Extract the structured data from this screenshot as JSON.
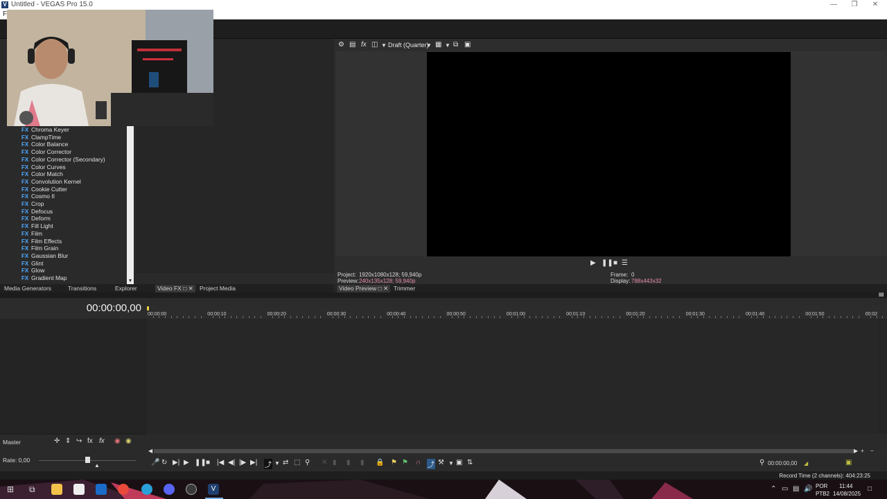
{
  "window": {
    "title": "Untitled - VEGAS Pro 15.0",
    "app_icon_letter": "V"
  },
  "menubar": {
    "first_item": "Fi"
  },
  "fx_list": [
    "Chroma Keyer",
    "ClampTime",
    "Color Balance",
    "Color Corrector",
    "Color Corrector (Secondary)",
    "Color Curves",
    "Color Match",
    "Convolution Kernel",
    "Cookie Cutter",
    "Cosmo II",
    "Crop",
    "Defocus",
    "Deform",
    "Fill Light",
    "Film",
    "Film Effects",
    "Film Grain",
    "Gaussian Blur",
    "Glint",
    "Glow",
    "Gradient Map"
  ],
  "fx_badge": "FX",
  "left_tabs": [
    "Media Generators",
    "Transitions",
    "Explorer",
    "Video FX",
    "Project Media"
  ],
  "preview_toolbar": {
    "quality": "Draft (Quarter)"
  },
  "preview_info": {
    "project_label": "Project:",
    "project_value": "1920x1080x128; 59,940p",
    "preview_label": "Preview:",
    "preview_value": "240x135x128; 59,940p",
    "frame_label": "Frame:",
    "frame_value": "0",
    "display_label": "Display:",
    "display_value": "788x443x32"
  },
  "preview_tabs": [
    "Video Preview",
    "Trimmer"
  ],
  "timeline": {
    "timecode": "00:00:00,00",
    "ruler": [
      "00:00:00",
      "00:00:10",
      "00:00:20",
      "00:00:30",
      "00:00:40",
      "00:00:50",
      "00:01:00",
      "00:01:10",
      "00:01:20",
      "00:01:30",
      "00:01:40",
      "00:01:50",
      "00:02"
    ]
  },
  "mixer": {
    "master_label": "Master",
    "rate_label": "Rate: 0,00"
  },
  "transport": {
    "cursor_time": "00:00:00,00"
  },
  "status": {
    "record_time": "Record Time (2 channels): 404:23:25"
  },
  "taskbar": {
    "lang1": "POR",
    "lang2": "PTB2",
    "time": "11:44",
    "date": "14/08/2025"
  },
  "colors": {
    "accent_fx": "#4fa8ff",
    "preview_pink": "#e68fb0",
    "background": "#2b2b2b"
  }
}
